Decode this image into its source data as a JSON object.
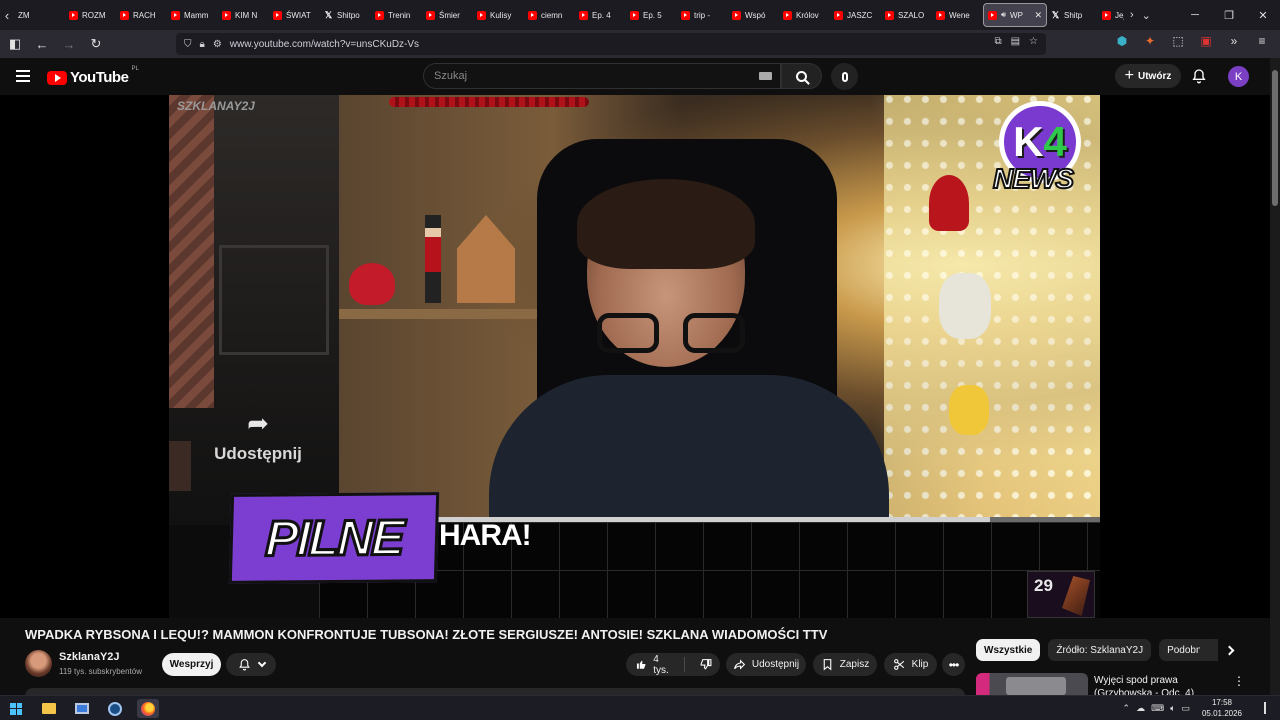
{
  "browser": {
    "tabs": [
      {
        "label": "ZM",
        "favicon": "none",
        "active": false
      },
      {
        "label": "ROZM",
        "favicon": "youtube",
        "active": false
      },
      {
        "label": "RACH",
        "favicon": "youtube",
        "active": false
      },
      {
        "label": "Mamm",
        "favicon": "youtube",
        "active": false
      },
      {
        "label": "KIM N",
        "favicon": "youtube",
        "active": false
      },
      {
        "label": "ŚWIAT",
        "favicon": "youtube",
        "active": false
      },
      {
        "label": "Shitpo",
        "favicon": "x",
        "active": false
      },
      {
        "label": "Trenin",
        "favicon": "youtube",
        "active": false
      },
      {
        "label": "Śmier",
        "favicon": "youtube",
        "active": false
      },
      {
        "label": "Kulisy",
        "favicon": "youtube",
        "active": false
      },
      {
        "label": "ciemn",
        "favicon": "youtube",
        "active": false
      },
      {
        "label": "Ep. 4",
        "favicon": "youtube",
        "active": false
      },
      {
        "label": "Ep. 5",
        "favicon": "youtube",
        "active": false
      },
      {
        "label": "trip -",
        "favicon": "youtube",
        "active": false
      },
      {
        "label": "Wspó",
        "favicon": "youtube",
        "active": false
      },
      {
        "label": "Królov",
        "favicon": "youtube",
        "active": false
      },
      {
        "label": "JASZC",
        "favicon": "youtube",
        "active": false
      },
      {
        "label": "SZALO",
        "favicon": "youtube",
        "active": false
      },
      {
        "label": "Wene",
        "favicon": "youtube",
        "active": false
      },
      {
        "label": "WP",
        "favicon": "youtube",
        "active": true
      },
      {
        "label": "Shitp",
        "favicon": "x",
        "active": false
      },
      {
        "label": "Jeju",
        "favicon": "youtube",
        "active": false
      }
    ],
    "url": "www.youtube.com/watch?v=unsCKuDz-Vs"
  },
  "youtube": {
    "logo_text": "YouTube",
    "country_code": "PL",
    "search_placeholder": "Szukaj",
    "create_label": "Utwórz",
    "avatar_letter": "K"
  },
  "player": {
    "channel_watermark": "SZKLANAY2J",
    "share_overlay_label": "Udostępnij",
    "news_logo_text": "NEWS",
    "banner_label": "PILNE",
    "ticker_text": "HARA!",
    "corner_counter": "29",
    "progress_fraction": 0.855
  },
  "video": {
    "title": "WPADKA RYBSONA I LEQU!? MAMMON KONFRONTUJE TUBSONA! ZŁOTE SERGIUSZE! ANTOSIE! SZKLANA WIADOMOŚCI TTV",
    "channel_name": "SzklanaY2J",
    "subscribers": "119 tys. subskrybentów",
    "support_label": "Wesprzyj",
    "like_count": "4 tys.",
    "share_label": "Udostępnij",
    "save_label": "Zapisz",
    "clip_label": "Klip"
  },
  "sidebar": {
    "chips": [
      "Wszystkie",
      "Źródło: SzklanaY2J",
      "Podobne"
    ],
    "recommendation_title": "Wyjęci spod prawa (Grzybowska - Odc. 4)"
  },
  "taskbar": {
    "time": "17:58",
    "date": "05.01.2026"
  },
  "colors": {
    "youtube_red": "#ff0000",
    "page_bg": "#0f0f0f",
    "avatar_purple": "#7b3fc4",
    "banner_purple": "#7c3ed0"
  }
}
